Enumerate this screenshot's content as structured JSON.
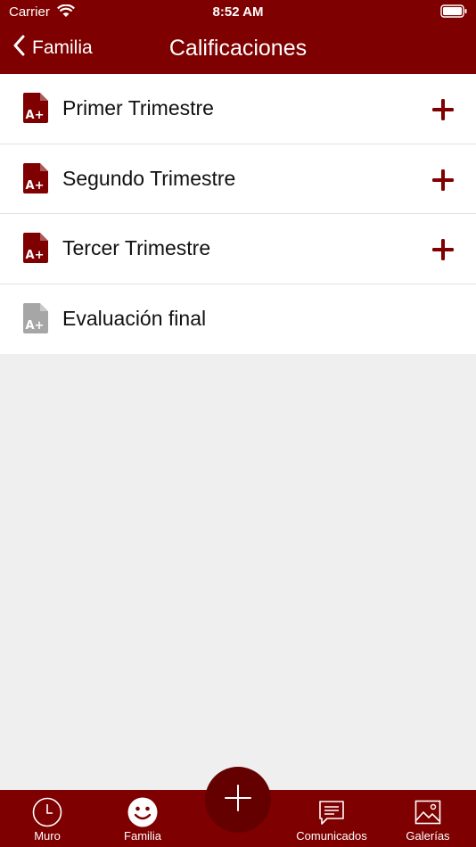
{
  "status_bar": {
    "carrier": "Carrier",
    "time": "8:52 AM"
  },
  "navbar": {
    "back_label": "Familia",
    "title": "Calificaciones"
  },
  "rows": [
    {
      "label": "Primer Trimestre",
      "has_add": true
    },
    {
      "label": "Segundo Trimestre",
      "has_add": true
    },
    {
      "label": "Tercer Trimestre",
      "has_add": true
    },
    {
      "label": "Evaluación final",
      "has_add": false
    }
  ],
  "tabs": [
    {
      "label": "Muro",
      "icon": "clock-icon"
    },
    {
      "label": "Familia",
      "icon": "smiley-icon"
    },
    {
      "label": "Comunicados",
      "icon": "message-icon"
    },
    {
      "label": "Galerías",
      "icon": "image-icon"
    }
  ],
  "colors": {
    "brand": "#7f0000",
    "fab": "#650000",
    "disabled_icon": "#a6a6a6"
  }
}
